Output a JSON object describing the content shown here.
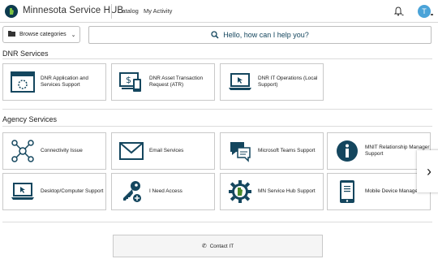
{
  "header": {
    "app_title": "Minnesota Service HUB",
    "nav": [
      {
        "label": "Catalog"
      },
      {
        "label": "My Activity"
      }
    ],
    "avatar_initial": "T",
    "icons": {
      "logo": "mn-logo-icon",
      "bell": "bell-icon"
    }
  },
  "toolbar": {
    "browse_label": "Browse categories",
    "search_prompt": "Hello, how can I help you?"
  },
  "sections": {
    "dnr": {
      "title": "DNR Services",
      "items": [
        {
          "label": "DNR Application and Services Support",
          "icon": "window-loading-icon"
        },
        {
          "label": "DNR Asset Transaction Request (ATR)",
          "icon": "money-device-icon"
        },
        {
          "label": "DNR IT Operations (Local Support)",
          "icon": "laptop-cursor-icon"
        }
      ]
    },
    "agency": {
      "title": "Agency Services",
      "items": [
        {
          "label": "Connectivity Issue",
          "icon": "network-nodes-icon"
        },
        {
          "label": "Email Services",
          "icon": "envelope-icon"
        },
        {
          "label": "Microsoft Teams Support",
          "icon": "chat-bubbles-icon"
        },
        {
          "label": "MNIT Relationship Manager Support",
          "icon": "info-circle-icon"
        },
        {
          "label": "Desktop/Computer Support",
          "icon": "laptop-cursor-icon"
        },
        {
          "label": "I Need Access",
          "icon": "key-plus-icon"
        },
        {
          "label": "MN Service Hub Support",
          "icon": "gear-mn-icon"
        },
        {
          "label": "Mobile Device Management",
          "icon": "mobile-device-icon"
        }
      ]
    }
  },
  "contact": {
    "label": "Contact IT",
    "icon": "phone-icon"
  },
  "colors": {
    "brand": "#0d3b4f",
    "accent": "#14465e",
    "avatar": "#4aa3d8"
  }
}
